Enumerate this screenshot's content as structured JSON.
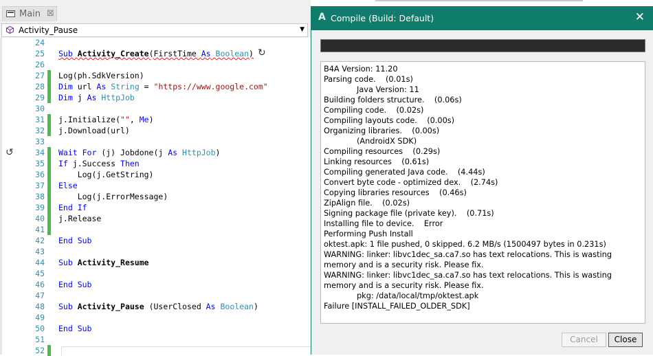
{
  "ide": {
    "tab": {
      "label": "Main",
      "close": "⊠"
    },
    "module_selector": {
      "value": "Activity_Pause"
    },
    "code_lines": [
      {
        "n": "24",
        "html": ""
      },
      {
        "n": "25",
        "html": "<span class=\"squig\"><span class=\"kw\">Sub</span> <span class=\"b\">Activity_Create</span>(FirstTime <span class=\"kw\">As</span> <span class=\"ty\">Boolean</span>)</span>"
      },
      {
        "n": "26",
        "html": ""
      },
      {
        "n": "27",
        "html": "Log(ph.SdkVersion)"
      },
      {
        "n": "28",
        "html": "<span class=\"kw\">Dim</span> url <span class=\"kw\">As</span> <span class=\"ty\">String</span> = <span class=\"str\">\"https://www.google.com\"</span>"
      },
      {
        "n": "29",
        "html": "<span class=\"kw\">Dim</span> j <span class=\"kw\">As</span> <span class=\"ty\">HttpJob</span>"
      },
      {
        "n": "30",
        "html": ""
      },
      {
        "n": "31",
        "html": "j.Initialize(<span class=\"str\">\"\"</span>, <span class=\"kw\">Me</span>)"
      },
      {
        "n": "32",
        "html": "j.Download(url)"
      },
      {
        "n": "33",
        "html": ""
      },
      {
        "n": "34",
        "html": "<span class=\"kw\">Wait For</span> (j) Jobdone(j <span class=\"kw\">As</span> <span class=\"ty\">HttpJob</span>)"
      },
      {
        "n": "35",
        "html": "<span class=\"kw\">If</span> j.Success <span class=\"kw\">Then</span>"
      },
      {
        "n": "36",
        "html": "    Log(j.GetString)"
      },
      {
        "n": "37",
        "html": "<span class=\"kw\">Else</span>"
      },
      {
        "n": "38",
        "html": "    Log(j.ErrorMessage)"
      },
      {
        "n": "39",
        "html": "<span class=\"kw\">End If</span>"
      },
      {
        "n": "40",
        "html": "j.Release"
      },
      {
        "n": "41",
        "html": ""
      },
      {
        "n": "42",
        "html": "<span class=\"kw\">End Sub</span>"
      },
      {
        "n": "43",
        "html": ""
      },
      {
        "n": "44",
        "html": "<span class=\"kw\">Sub</span> <span class=\"b\">Activity_Resume</span>"
      },
      {
        "n": "45",
        "html": ""
      },
      {
        "n": "46",
        "html": "<span class=\"kw\">End Sub</span>"
      },
      {
        "n": "47",
        "html": ""
      },
      {
        "n": "48",
        "html": "<span class=\"kw\">Sub</span> <span class=\"b\">Activity_Pause</span> (UserClosed <span class=\"kw\">As</span> <span class=\"ty\">Boolean</span>)"
      },
      {
        "n": "49",
        "html": ""
      },
      {
        "n": "50",
        "html": "<span class=\"kw\">End Sub</span>"
      },
      {
        "n": "51",
        "html": ""
      },
      {
        "n": "52",
        "html": ""
      }
    ],
    "changed_lines": [
      "27",
      "28",
      "29",
      "31",
      "32",
      "34",
      "35",
      "36",
      "37",
      "38",
      "39",
      "40",
      "41",
      "52"
    ]
  },
  "dialog": {
    "logo": "A",
    "title": "Compile (Build: Default)",
    "close_icon": "✕",
    "progress_percent": 100,
    "log": [
      {
        "t": "B4A Version: 11.20",
        "indent": false
      },
      {
        "t": "Parsing code.    (0.01s)",
        "indent": false
      },
      {
        "t": "Java Version: 11",
        "indent": true
      },
      {
        "t": "Building folders structure.    (0.06s)",
        "indent": false
      },
      {
        "t": "Compiling code.    (0.02s)",
        "indent": false
      },
      {
        "t": "Compiling layouts code.    (0.00s)",
        "indent": false
      },
      {
        "t": "Organizing libraries.    (0.00s)",
        "indent": false
      },
      {
        "t": "(AndroidX SDK)",
        "indent": true
      },
      {
        "t": "Compiling resources    (0.29s)",
        "indent": false
      },
      {
        "t": "Linking resources    (0.61s)",
        "indent": false
      },
      {
        "t": "Compiling generated Java code.    (4.44s)",
        "indent": false
      },
      {
        "t": "Convert byte code - optimized dex.    (2.74s)",
        "indent": false
      },
      {
        "t": "Copying libraries resources    (0.46s)",
        "indent": false
      },
      {
        "t": "ZipAlign file.    (0.02s)",
        "indent": false
      },
      {
        "t": "Signing package file (private key).    (0.71s)",
        "indent": false
      },
      {
        "t": "Installing file to device.    Error",
        "indent": false
      },
      {
        "t": "Performing Push Install",
        "indent": false
      },
      {
        "t": "oktest.apk: 1 file pushed, 0 skipped. 6.2 MB/s (1500497 bytes in 0.231s)",
        "indent": false
      },
      {
        "t": "WARNING: linker: libvc1dec_sa.ca7.so has text relocations. This is wasting memory and is a security risk. Please fix.",
        "indent": false
      },
      {
        "t": "WARNING: linker: libvc1dec_sa.ca7.so has text relocations. This is wasting memory and is a security risk. Please fix.",
        "indent": false
      },
      {
        "t": "pkg: /data/local/tmp/oktest.apk",
        "indent": true
      },
      {
        "t": "Failure [INSTALL_FAILED_OLDER_SDK]",
        "indent": false
      }
    ],
    "buttons": {
      "cancel": "Cancel",
      "close": "Close"
    }
  },
  "colors": {
    "title_bar": "#107c6b",
    "keyword": "#0000ff",
    "type": "#2b91af",
    "string": "#a31515",
    "change_marker": "#4cbb4c"
  }
}
